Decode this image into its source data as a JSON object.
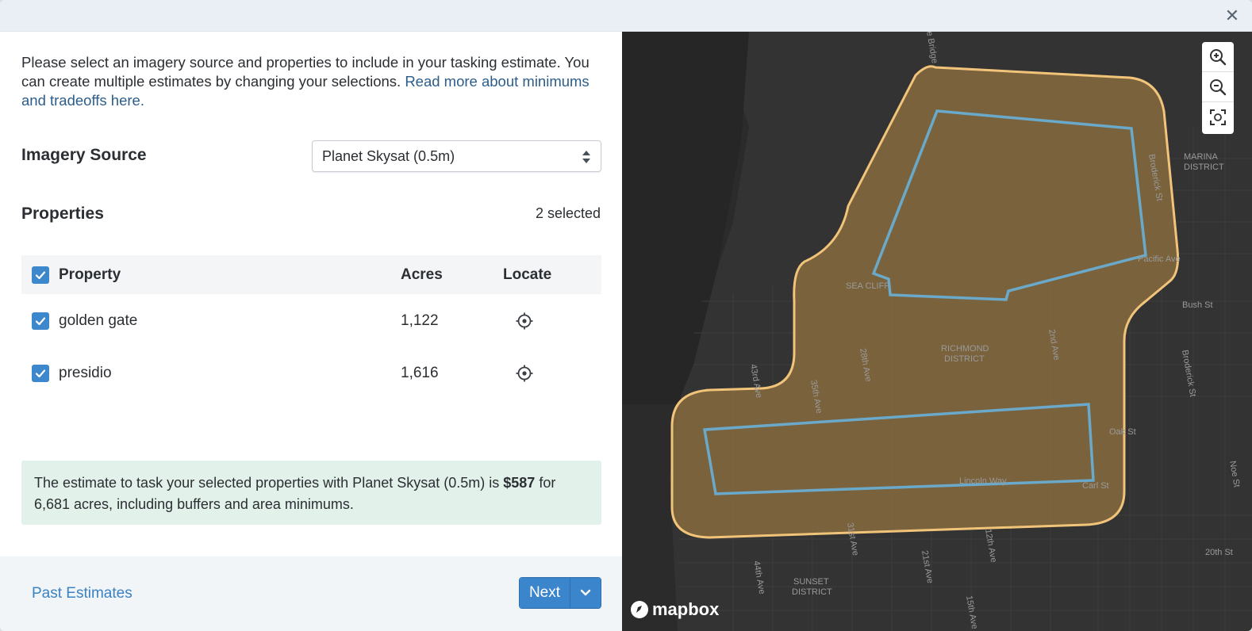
{
  "window": {
    "close_icon": "close-icon"
  },
  "intro": {
    "text": "Please select an imagery source and properties to include in your tasking estimate. You can create multiple estimates by changing your selections.",
    "link": "Read more about minimums and tradeoffs here."
  },
  "imagery": {
    "label": "Imagery Source",
    "selected": "Planet Skysat (0.5m)"
  },
  "properties": {
    "label": "Properties",
    "selected_count": "2 selected",
    "columns": [
      "Property",
      "Acres",
      "Locate"
    ],
    "rows": [
      {
        "name": "golden gate",
        "acres": "1,122",
        "checked": true
      },
      {
        "name": "presidio",
        "acres": "1,616",
        "checked": true
      }
    ]
  },
  "estimate": {
    "prefix": "The estimate to task your selected properties with Planet Skysat (0.5m) is",
    "price": "$587",
    "suffix": "for 6,681 acres, including buffers and area minimums."
  },
  "footer": {
    "past_estimates": "Past Estimates",
    "next": "Next"
  },
  "map": {
    "attribution": "mapbox",
    "labels": {
      "marina": [
        "MARINA",
        "DISTRICT"
      ],
      "richmond": [
        "RICHMOND",
        "DISTRICT"
      ],
      "sunset": [
        "SUNSET",
        "DISTRICT"
      ],
      "sea_cliff": "SEA CLIFF",
      "streets": {
        "bush": "Bush St",
        "oak": "Oak St",
        "carl": "Carl St",
        "lincoln": "Lincoln Way",
        "pacific": "Pacific Ave",
        "broderick_n": "Broderick St",
        "broderick_s": "Broderick St",
        "ave43": "43rd Ave",
        "ave35": "35th Ave",
        "ave28": "28th Ave",
        "ave2": "2nd Ave",
        "ave31": "31st Ave",
        "ave21": "21st Ave",
        "ave12": "12th Ave",
        "ave44": "44th Ave",
        "ave15": "15th Ave",
        "ave20": "20th St",
        "noe": "Noe St",
        "bridge": "e Bridge"
      }
    },
    "colors": {
      "buffer_fill": "#8a6d3f",
      "buffer_stroke": "#f2c47a",
      "property_stroke": "#6aa9c9",
      "checkbox": "#3d87cc",
      "estimate_bg": "#e2f1ea"
    }
  }
}
